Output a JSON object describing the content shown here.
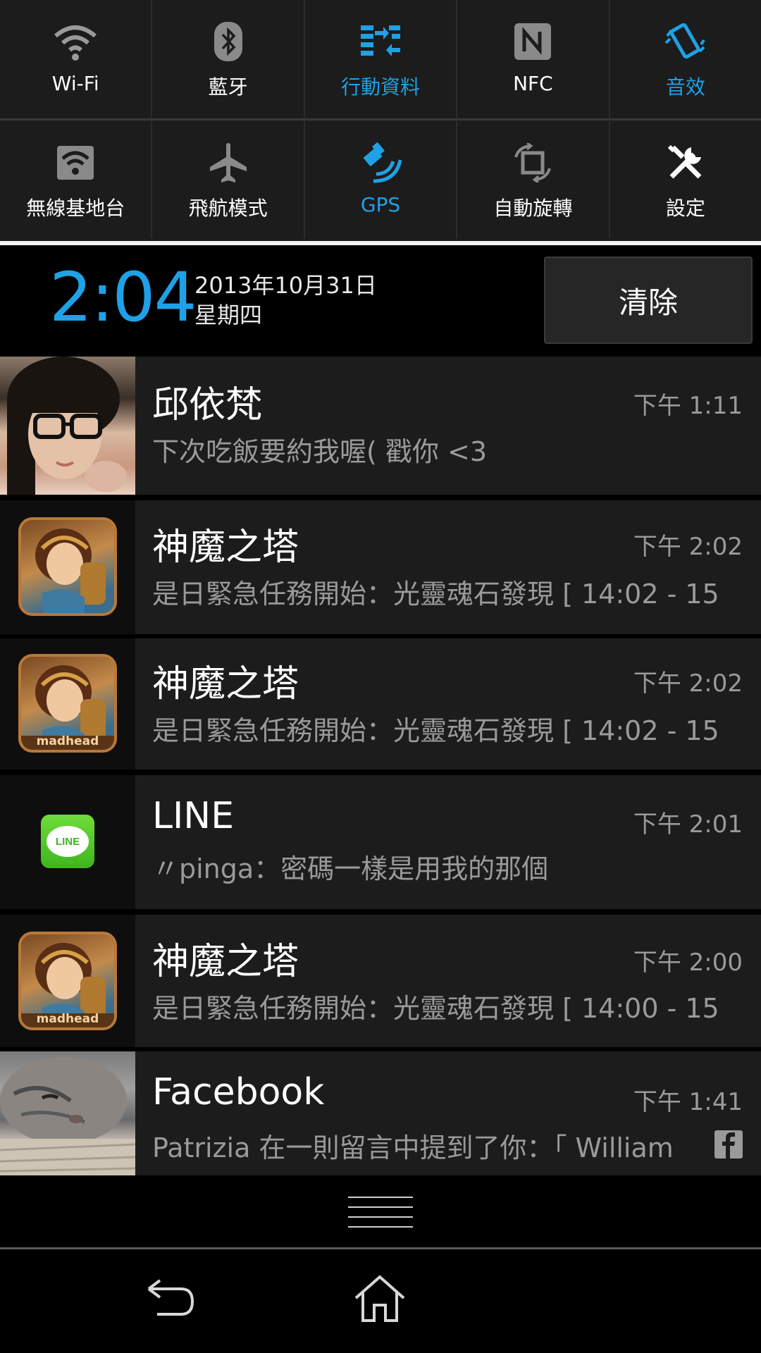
{
  "quick_settings": {
    "row1": [
      {
        "label": "Wi-Fi",
        "icon": "wifi-icon",
        "on": false
      },
      {
        "label": "藍牙",
        "icon": "bluetooth-icon",
        "on": false
      },
      {
        "label": "行動資料",
        "icon": "mobile-data-icon",
        "on": true
      },
      {
        "label": "NFC",
        "icon": "nfc-icon",
        "on": false
      },
      {
        "label": "音效",
        "icon": "vibrate-icon",
        "on": true
      }
    ],
    "row2": [
      {
        "label": "無線基地台",
        "icon": "hotspot-icon",
        "on": false
      },
      {
        "label": "飛航模式",
        "icon": "airplane-icon",
        "on": false
      },
      {
        "label": "GPS",
        "icon": "gps-icon",
        "on": true
      },
      {
        "label": "自動旋轉",
        "icon": "rotate-icon",
        "on": false
      },
      {
        "label": "設定",
        "icon": "settings-icon",
        "on": false
      }
    ]
  },
  "header": {
    "time": "2:04",
    "date": "2013年10月31日",
    "weekday": "星期四",
    "clear_label": "清除"
  },
  "notifications": [
    {
      "title": "邱依梵",
      "time": "下午 1:11",
      "text": "下次吃飯要約我喔( 戳你 <3",
      "icon": "contact-photo"
    },
    {
      "title": "神魔之塔",
      "time": "下午 2:02",
      "text": "是日緊急任務開始：光靈魂石發現 [ 14:02 - 15",
      "icon": "tower-of-saviors-icon"
    },
    {
      "title": "神魔之塔",
      "time": "下午 2:02",
      "text": "是日緊急任務開始：光靈魂石發現 [ 14:02 - 15",
      "icon": "tower-of-saviors-icon",
      "badge": "madhead"
    },
    {
      "title": "LINE",
      "time": "下午 2:01",
      "text": "〃pinga：密碼一樣是用我的那個",
      "icon": "line-icon",
      "icon_text": "LINE"
    },
    {
      "title": "神魔之塔",
      "time": "下午 2:00",
      "text": "是日緊急任務開始：光靈魂石發現 [ 14:00 - 15",
      "icon": "tower-of-saviors-icon",
      "badge": "madhead"
    },
    {
      "title": "Facebook",
      "time": "下午 1:41",
      "text": "Patrizia 在一則留言中提到了你：「 William",
      "icon": "cat-photo",
      "small_icon": "facebook-icon"
    }
  ],
  "colors": {
    "accent": "#1ea1e6",
    "panel": "#1c1c1c",
    "secondary_text": "#9a9a9a"
  }
}
